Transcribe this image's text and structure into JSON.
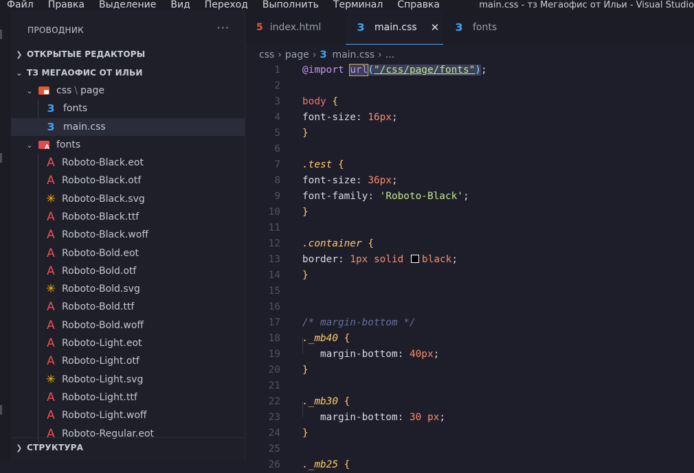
{
  "menubar": {
    "items": [
      "Файл",
      "Правка",
      "Выделение",
      "Вид",
      "Переход",
      "Выполнить",
      "Терминал",
      "Справка"
    ],
    "window_title": "main.css - тз Мегаофис от Ильи - Visual Studio"
  },
  "explorer": {
    "header": "ПРОВОДНИК",
    "more": "···",
    "open_editors": "ОТКРЫТЫЕ РЕДАКТОРЫ",
    "workspace": "ТЗ МЕГАОФИС ОТ ИЛЬИ",
    "folder_css": "css",
    "folder_css_sep": "\\",
    "folder_css_sub": "page",
    "file_fonts": "fonts",
    "file_main": "main.css",
    "folder_fonts": "fonts",
    "font_files": [
      {
        "name": "Roboto-Black.eot",
        "kind": "font"
      },
      {
        "name": "Roboto-Black.otf",
        "kind": "font"
      },
      {
        "name": "Roboto-Black.svg",
        "kind": "svg"
      },
      {
        "name": "Roboto-Black.ttf",
        "kind": "font"
      },
      {
        "name": "Roboto-Black.woff",
        "kind": "font"
      },
      {
        "name": "Roboto-Bold.eot",
        "kind": "font"
      },
      {
        "name": "Roboto-Bold.otf",
        "kind": "font"
      },
      {
        "name": "Roboto-Bold.svg",
        "kind": "svg"
      },
      {
        "name": "Roboto-Bold.ttf",
        "kind": "font"
      },
      {
        "name": "Roboto-Bold.woff",
        "kind": "font"
      },
      {
        "name": "Roboto-Light.eot",
        "kind": "font"
      },
      {
        "name": "Roboto-Light.otf",
        "kind": "font"
      },
      {
        "name": "Roboto-Light.svg",
        "kind": "svg"
      },
      {
        "name": "Roboto-Light.ttf",
        "kind": "font"
      },
      {
        "name": "Roboto-Light.woff",
        "kind": "font"
      },
      {
        "name": "Roboto-Regular.eot",
        "kind": "font"
      }
    ],
    "outline": "СТРУКТУРА"
  },
  "tabs": [
    {
      "label": "index.html",
      "icon": "html5-icon",
      "active": false
    },
    {
      "label": "main.css",
      "icon": "css3-icon",
      "active": true
    },
    {
      "label": "fonts",
      "icon": "css3-icon",
      "active": false
    }
  ],
  "tab_close": "✕",
  "breadcrumb": [
    "css",
    "page",
    "main.css",
    "..."
  ],
  "code": {
    "line_numbers": [
      "1",
      "2",
      "3",
      "4",
      "5",
      "6",
      "7",
      "8",
      "9",
      "10",
      "11",
      "12",
      "13",
      "14",
      "15",
      "16",
      "17",
      "18",
      "19",
      "20",
      "21",
      "22",
      "23",
      "24",
      "25"
    ],
    "at_import": "@import",
    "url_fn": "url",
    "url_arg": "\"/css/page/fonts\"",
    "body_sel": "body",
    "prop_font_size": "font-size",
    "val_16": "16px",
    "cls_test": ".test",
    "val_36": "36px",
    "prop_font_family": "font-family",
    "val_family": "'Roboto-Black'",
    "cls_container": ".container",
    "prop_border": "border",
    "val_1px": "1px",
    "val_solid": "solid",
    "val_black": "black",
    "comment": "/* margin-bottom */",
    "cls_mb40": "._mb40",
    "prop_margin_bottom": "margin-bottom",
    "val_40": "40px",
    "cls_mb30": "._mb30",
    "val_30": "30",
    "val_px": "px",
    "cls_mb25": "._mb25",
    "brace_open": "{",
    "brace_close": "}",
    "colon": ":",
    "semi": ";",
    "colors": {
      "accent": "#5da3e6",
      "selector": "#f07178",
      "brace": "#ffcb6b",
      "number": "#f78c6c",
      "string": "#c3e88d",
      "keyword": "#c792ea"
    }
  }
}
